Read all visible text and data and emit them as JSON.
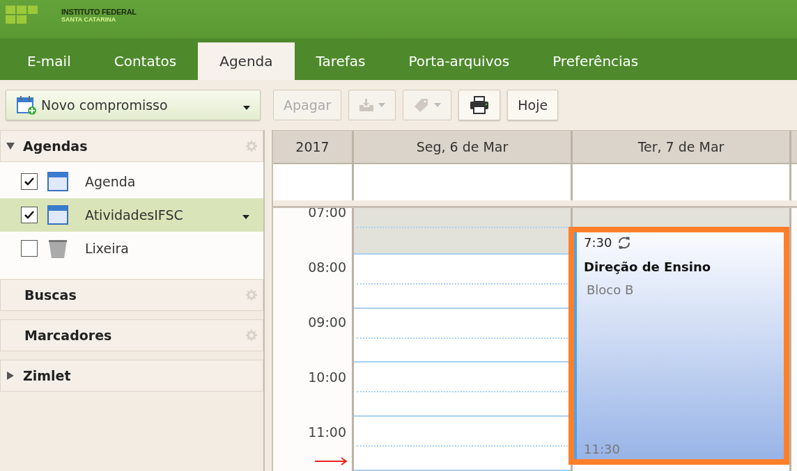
{
  "logo": {
    "title": "INSTITUTO FEDERAL",
    "subtitle": "SANTA CATARINA"
  },
  "tabs": [
    {
      "label": "E-mail",
      "selected": false
    },
    {
      "label": "Contatos",
      "selected": false
    },
    {
      "label": "Agenda",
      "selected": true
    },
    {
      "label": "Tarefas",
      "selected": false
    },
    {
      "label": "Porta-arquivos",
      "selected": false
    },
    {
      "label": "Preferências",
      "selected": false
    }
  ],
  "toolbar": {
    "new_button": {
      "label": "Novo compromisso"
    },
    "buttons": [
      {
        "kind": "text",
        "label": "Apagar",
        "disabled": true
      },
      {
        "kind": "move",
        "disabled": true
      },
      {
        "kind": "tag",
        "disabled": true
      },
      {
        "kind": "print",
        "disabled": false
      },
      {
        "kind": "text",
        "label": "Hoje",
        "disabled": false
      }
    ]
  },
  "sidebar": {
    "sections": [
      {
        "title": "Agendas",
        "expanded": true,
        "items": [
          {
            "label": "Agenda",
            "kind": "calendar",
            "checked": true,
            "selected": false
          },
          {
            "label": "AtividadesIFSC",
            "kind": "calendar",
            "checked": true,
            "selected": true
          },
          {
            "label": "Lixeira",
            "kind": "trash",
            "checked": false,
            "selected": false
          }
        ]
      },
      {
        "title": "Buscas"
      },
      {
        "title": "Marcadores"
      },
      {
        "title": "Zimlet",
        "expanded": false
      }
    ]
  },
  "calendar": {
    "year": "2017",
    "days": [
      "Seg, 6 de Mar",
      "Ter, 7 de Mar"
    ],
    "hours": [
      {
        "label": "07:00",
        "shaded": true
      },
      {
        "label": "08:00",
        "shaded": false
      },
      {
        "label": "09:00",
        "shaded": false
      },
      {
        "label": "10:00",
        "shaded": false
      },
      {
        "label": "11:00",
        "shaded": false
      }
    ],
    "event": {
      "start": "7:30",
      "title": "Direção de Ensino",
      "location": "Bloco B",
      "end": "11:30",
      "recurring": true,
      "selected": true
    }
  }
}
